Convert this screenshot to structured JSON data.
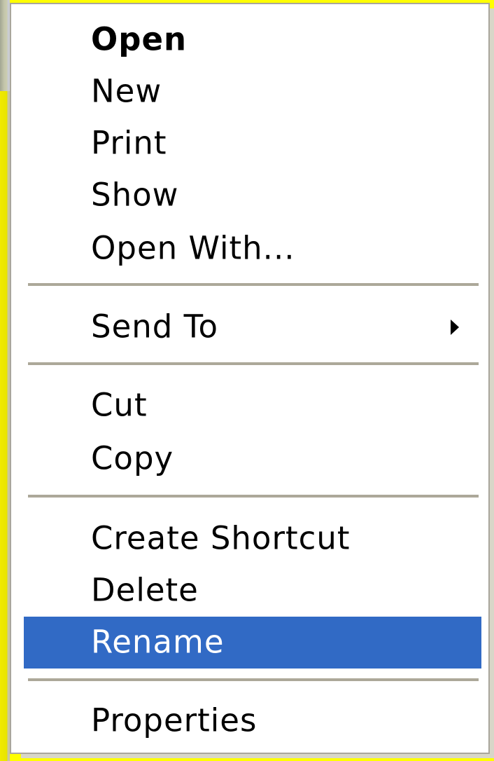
{
  "context_menu": {
    "groups": [
      {
        "items": [
          {
            "label": "Open",
            "bold": true
          },
          {
            "label": "New"
          },
          {
            "label": "Print"
          },
          {
            "label": "Show"
          },
          {
            "label": "Open With..."
          }
        ]
      },
      {
        "items": [
          {
            "label": "Send To",
            "submenu": true
          }
        ]
      },
      {
        "items": [
          {
            "label": "Cut"
          },
          {
            "label": "Copy"
          }
        ]
      },
      {
        "items": [
          {
            "label": "Create Shortcut"
          },
          {
            "label": "Delete"
          },
          {
            "label": "Rename",
            "selected": true
          }
        ]
      },
      {
        "items": [
          {
            "label": "Properties"
          }
        ]
      }
    ],
    "colors": {
      "highlight": "#316ac5",
      "highlight_text": "#ffffff",
      "separator": "#aca899",
      "background_outside": "#ffff00"
    }
  }
}
